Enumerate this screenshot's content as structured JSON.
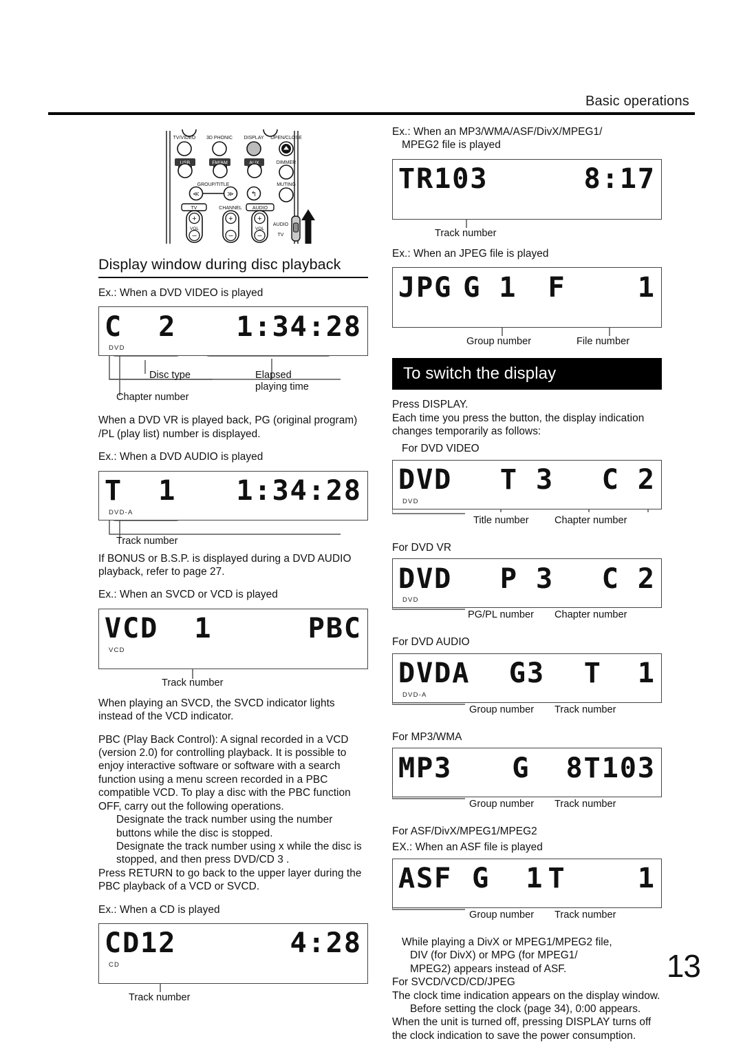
{
  "header": {
    "title": "Basic operations",
    "page_number": "13"
  },
  "remote": {
    "buttons_row1": [
      "TV/VIDEO",
      "3D PHONIC",
      "DISPLAY",
      "OPEN/CLOSE"
    ],
    "buttons_row2": [
      "USB",
      "FM/AM",
      "AUX",
      "DIMMER"
    ],
    "buttons_row3": [
      "GROUP/TITLE",
      "MUTING"
    ],
    "buttons_row4": [
      "TV",
      "CHANNEL",
      "AUDIO"
    ],
    "vol_label": "VOL",
    "switch_labels": [
      "AUDIO",
      "TV"
    ],
    "plus": "+",
    "minus": "–"
  },
  "left": {
    "heading": "Display window during disc playback",
    "ex_dvd_video": "Ex.: When a DVD VIDEO is played",
    "lcd_dvd_video": {
      "left": "C  2",
      "right": "1:34:28",
      "indicator": "DVD"
    },
    "callouts_dvd_video": {
      "disc_type": "Disc type",
      "chapter_number": "Chapter number",
      "elapsed_line1": "Elapsed",
      "elapsed_line2": "playing time"
    },
    "note_dvd_vr": "When a DVD VR is played back, PG (original program) /PL (play list) number is displayed.",
    "ex_dvd_audio": "Ex.: When a DVD AUDIO is played",
    "lcd_dvd_audio": {
      "left": "T  1",
      "right": "1:34:28",
      "indicator": "DVD-A"
    },
    "callout_track_number": "Track number",
    "note_bonus": "If  BONUS  or  B.S.P.  is displayed during a DVD AUDIO playback, refer to page 27.",
    "ex_svcd_vcd": "Ex.: When an SVCD or VCD is played",
    "lcd_vcd": {
      "left": "VCD  1",
      "right": "PBC",
      "indicator": "VCD"
    },
    "callout_track_number2": "Track number",
    "note_svcd": "When playing an SVCD, the SVCD indicator lights instead of the VCD indicator.",
    "note_pbc": "PBC (Play Back Control): A signal recorded in a VCD (version 2.0) for controlling playback. It is possible to enjoy interactive software or software with a search function using a menu screen recorded in a PBC compatible VCD. To play a disc with the PBC function OFF, carry out the following operations.",
    "pbc_step1": "Designate the track number using the number buttons while the disc is stopped.",
    "pbc_step2": "Designate the track number using x      while the disc is stopped, and then press DVD/CD 3  .",
    "note_return": "Press RETURN to go back to the upper layer during the PBC playback of a VCD or SVCD.",
    "ex_cd": "Ex.: When a CD is played",
    "lcd_cd": {
      "left": "CD12",
      "right": "4:28",
      "indicator": "CD"
    },
    "callout_track_number3": "Track number"
  },
  "right": {
    "ex_mp3_line1": "Ex.:  When an MP3/WMA/ASF/DivX/MPEG1/",
    "ex_mp3_line2": "MPEG2 file is played",
    "lcd_mp3file": {
      "left": "TR103",
      "right": "8:17",
      "indicator": ""
    },
    "callout_track_number": "Track number",
    "ex_jpeg": "Ex.: When an JPEG file is played",
    "lcd_jpeg": {
      "left": "JPG",
      "mid": "G 1",
      "right": "F    1",
      "indicator": ""
    },
    "callout_group_number": "Group number",
    "callout_file_number": "File number",
    "banner": "To switch the display",
    "press_display": "Press DISPLAY.",
    "each_time": "Each time you press the button, the display indication changes temporarily as follows:",
    "for_dvd_video": "For DVD VIDEO",
    "lcd_dvd_video": {
      "a": "DVD",
      "b": "T 3",
      "c": "C 2",
      "indicator": "DVD"
    },
    "callout_title_number": "Title number",
    "callout_chapter_number": "Chapter number",
    "for_dvd_vr": "For DVD VR",
    "lcd_dvd_vr": {
      "a": "DVD",
      "b": "P 3",
      "c": "C 2",
      "indicator": "DVD"
    },
    "callout_pgpl_number": "PG/PL number",
    "callout_chapter_number2": "Chapter number",
    "for_dvd_audio": "For DVD AUDIO",
    "lcd_dvd_audio": {
      "a": "DVDA",
      "b": "G3",
      "c": "T  1",
      "indicator": "DVD-A"
    },
    "callout_group_number2": "Group number",
    "callout_track_number2": "Track number",
    "for_mp3_wma": "For MP3/WMA",
    "lcd_mp3": {
      "a": "MP3",
      "b": "G  8",
      "c": "T103",
      "indicator": ""
    },
    "callout_group_number3": "Group number",
    "callout_track_number3": "Track number",
    "for_asf": "For ASF/DivX/MPEG1/MPEG2",
    "ex_asf": "EX.: When an ASF file is played",
    "lcd_asf": {
      "a": "ASF",
      "b": "G  1",
      "c": "T    1",
      "indicator": ""
    },
    "callout_group_number4": "Group number",
    "callout_track_number4": "Track number",
    "note_divx_line1": "While playing a DivX or MPEG1/MPEG2 file,",
    "note_divx_line2": "DIV (for DivX)  or  MPG (for MPEG1/",
    "note_divx_line3": "MPEG2)  appears instead of  ASF.",
    "for_svcd": "For SVCD/VCD/CD/JPEG",
    "note_clock": "The clock time indication appears on the display window.",
    "note_before_clock": "Before setting the clock (page 34),  0:00 appears.",
    "note_power_off": "When the unit is turned off, pressing DISPLAY turns off the clock indication to save the power consumption."
  }
}
